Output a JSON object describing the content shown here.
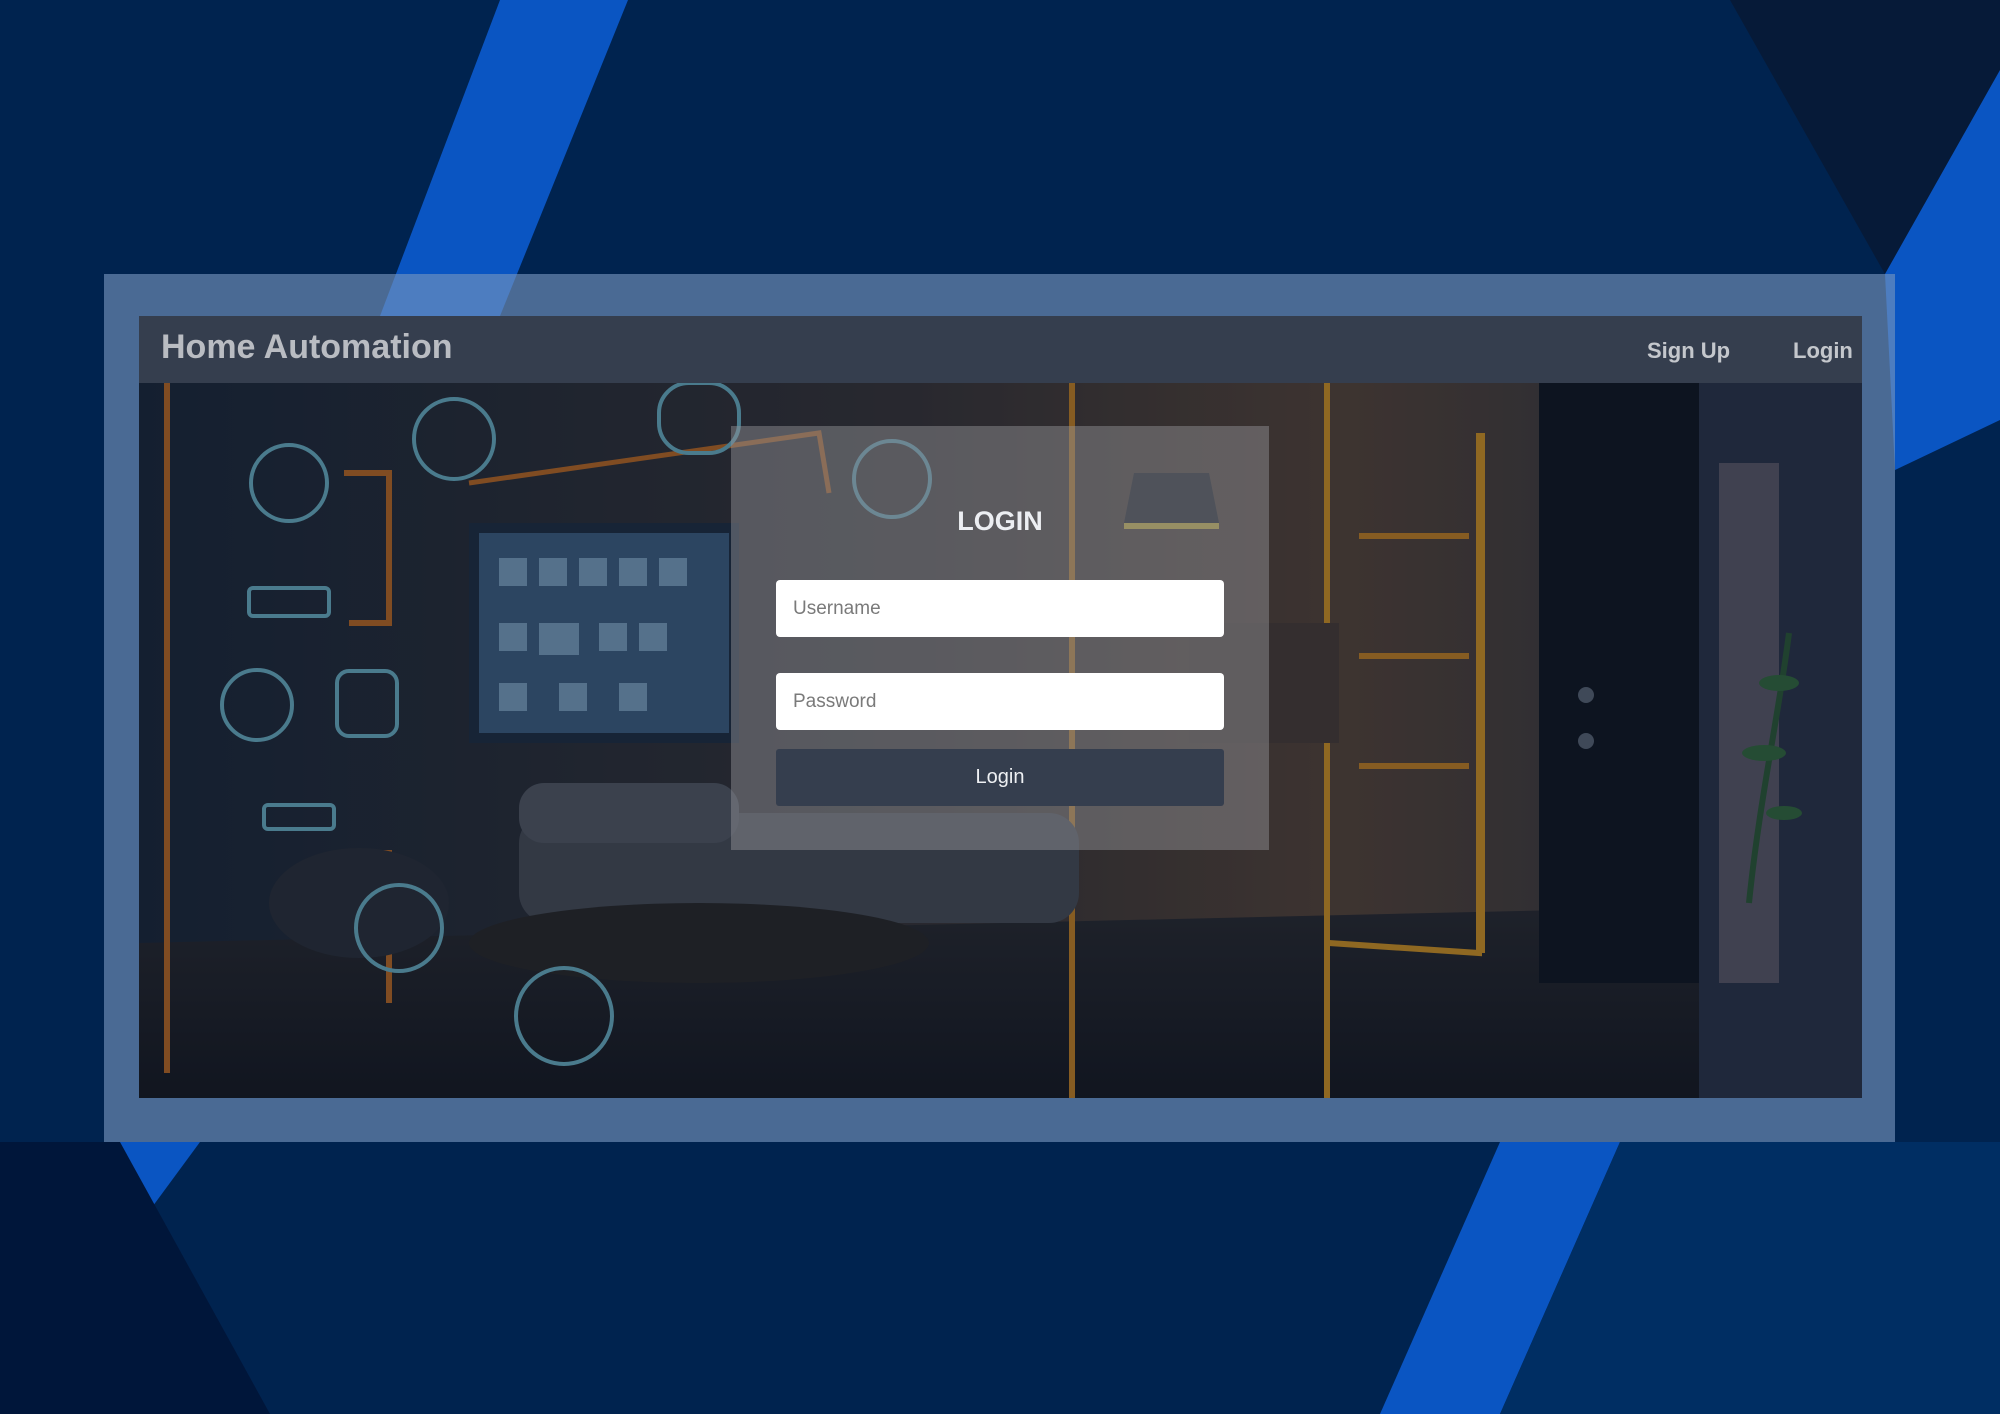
{
  "header": {
    "brand": "Home Automation",
    "links": [
      {
        "label": "Sign Up"
      },
      {
        "label": "Login"
      }
    ]
  },
  "login_form": {
    "title": "LOGIN",
    "username_placeholder": "Username",
    "password_placeholder": "Password",
    "submit_label": "Login"
  },
  "colors": {
    "page_background": "#00234f",
    "accent_blue": "#0a55c2",
    "navbar": "#353e4e",
    "button": "#353e4e",
    "frame": "#7896be"
  },
  "hero_image": "smart-home-interior-illustration"
}
